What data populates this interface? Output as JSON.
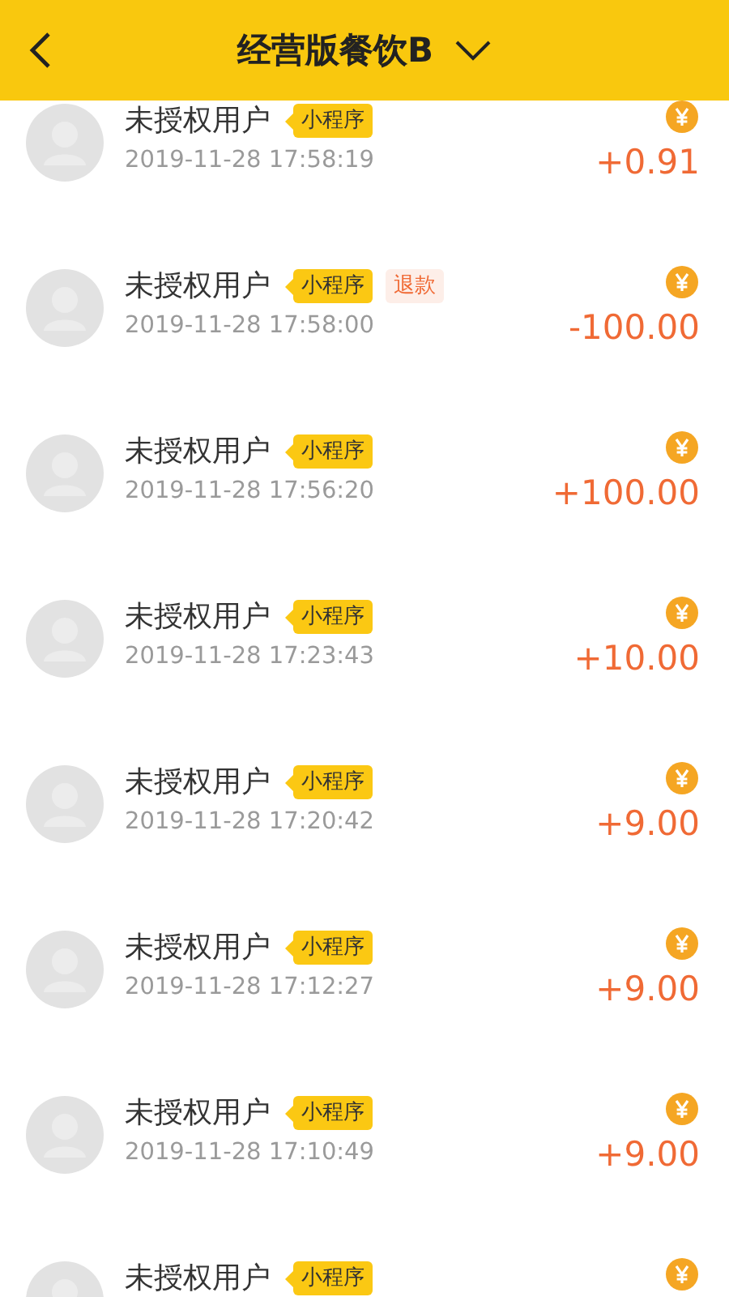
{
  "header": {
    "title": "经营版餐饮B"
  },
  "records": [
    {
      "name": "未授权用户",
      "tags": [
        {
          "kind": "source",
          "label": "小程序"
        }
      ],
      "time": "2019-11-28 17:58:19",
      "amount": "+0.91"
    },
    {
      "name": "未授权用户",
      "tags": [
        {
          "kind": "source",
          "label": "小程序"
        },
        {
          "kind": "refund",
          "label": "退款"
        }
      ],
      "time": "2019-11-28 17:58:00",
      "amount": "-100.00"
    },
    {
      "name": "未授权用户",
      "tags": [
        {
          "kind": "source",
          "label": "小程序"
        }
      ],
      "time": "2019-11-28 17:56:20",
      "amount": "+100.00"
    },
    {
      "name": "未授权用户",
      "tags": [
        {
          "kind": "source",
          "label": "小程序"
        }
      ],
      "time": "2019-11-28 17:23:43",
      "amount": "+10.00"
    },
    {
      "name": "未授权用户",
      "tags": [
        {
          "kind": "source",
          "label": "小程序"
        }
      ],
      "time": "2019-11-28 17:20:42",
      "amount": "+9.00"
    },
    {
      "name": "未授权用户",
      "tags": [
        {
          "kind": "source",
          "label": "小程序"
        }
      ],
      "time": "2019-11-28 17:12:27",
      "amount": "+9.00"
    },
    {
      "name": "未授权用户",
      "tags": [
        {
          "kind": "source",
          "label": "小程序"
        }
      ],
      "time": "2019-11-28 17:10:49",
      "amount": "+9.00"
    },
    {
      "name": "未授权用户",
      "tags": [
        {
          "kind": "source",
          "label": "小程序"
        }
      ]
    }
  ]
}
